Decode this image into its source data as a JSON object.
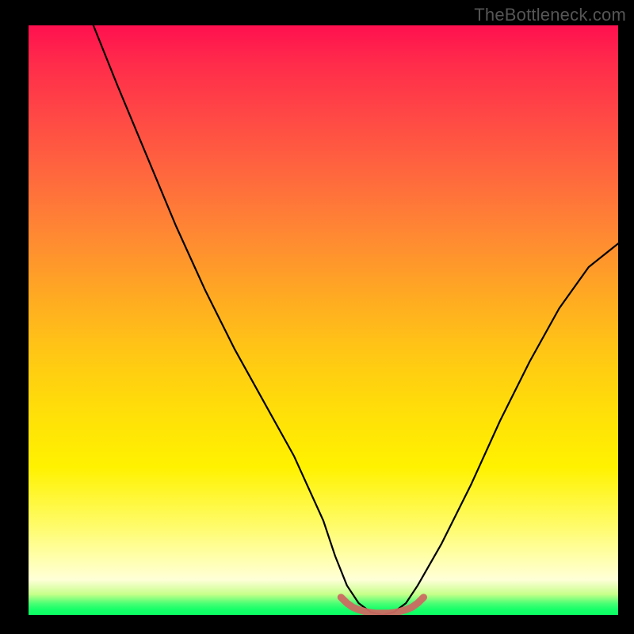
{
  "watermark": "TheBottleneck.com",
  "chart_data": {
    "type": "line",
    "title": "",
    "xlabel": "",
    "ylabel": "",
    "xlim": [
      0,
      100
    ],
    "ylim": [
      0,
      100
    ],
    "grid": false,
    "series": [
      {
        "name": "curve",
        "color": "#000000",
        "x": [
          11,
          15,
          20,
          25,
          30,
          35,
          40,
          45,
          50,
          52,
          54,
          56,
          58,
          60,
          62,
          64,
          66,
          70,
          75,
          80,
          85,
          90,
          95,
          100
        ],
        "y": [
          100,
          90,
          78,
          66,
          55,
          45,
          36,
          27,
          16,
          10,
          5,
          2,
          0.5,
          0,
          0.5,
          2,
          5,
          12,
          22,
          33,
          43,
          52,
          59,
          63
        ]
      },
      {
        "name": "bottom-marker",
        "color": "#cc6a62",
        "x": [
          53,
          54,
          55,
          56,
          57,
          58,
          59,
          60,
          61,
          62,
          63,
          64,
          65,
          66,
          67
        ],
        "y": [
          3,
          2,
          1.3,
          0.9,
          0.6,
          0.4,
          0.3,
          0.3,
          0.3,
          0.4,
          0.6,
          0.9,
          1.3,
          2,
          3
        ]
      }
    ]
  }
}
